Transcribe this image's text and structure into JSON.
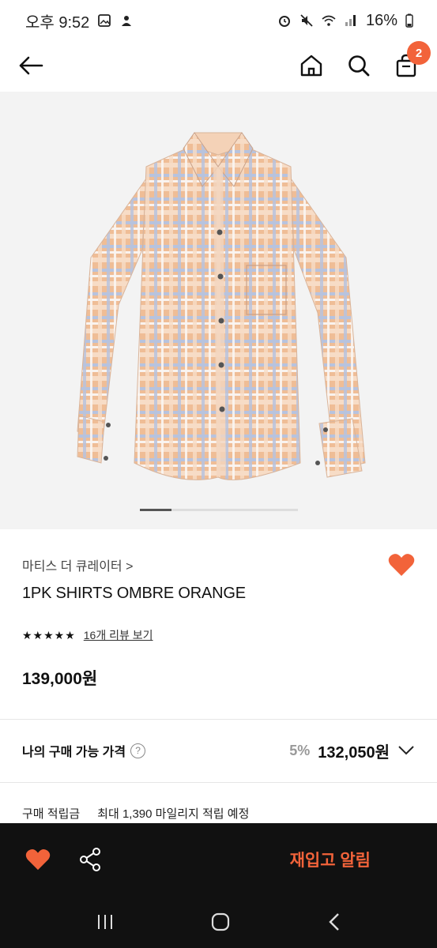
{
  "status": {
    "time": "오후 9:52",
    "battery": "16%"
  },
  "header": {
    "cart_count": "2"
  },
  "product": {
    "brand": "마티스 더 큐레이터 >",
    "name": "1PK SHIRTS OMBRE ORANGE",
    "stars": "★★★★★",
    "review_link": "16개 리뷰 보기",
    "price": "139,000원"
  },
  "my_price": {
    "label": "나의 구매 가능 가격",
    "help": "?",
    "discount": "5%",
    "sale_price": "132,050원"
  },
  "mileage": {
    "label": "구매 적립금",
    "value": "최대 1,390 마일리지 적립 예정"
  },
  "bottom_bar": {
    "restock_label": "재입고 알림"
  },
  "colors": {
    "accent": "#f2633a",
    "dark": "#111111"
  },
  "icons": {
    "back": "arrow-left-icon",
    "home": "home-icon",
    "search": "search-icon",
    "cart": "shopping-bag-icon",
    "like": "heart-icon",
    "share": "share-icon"
  }
}
